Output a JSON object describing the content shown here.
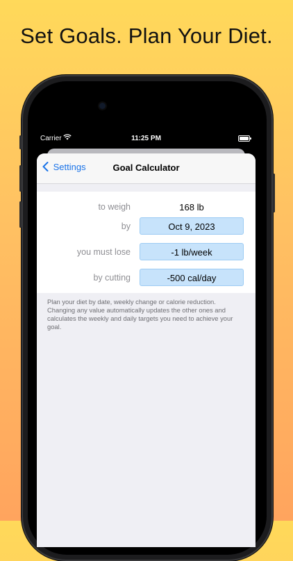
{
  "headline": "Set Goals. Plan Your Diet.",
  "status_bar": {
    "carrier": "Carrier",
    "time": "11:25 PM"
  },
  "nav": {
    "back_label": "Settings",
    "title": "Goal Calculator"
  },
  "form": {
    "rows": [
      {
        "label": "to weigh",
        "value": "168 lb"
      },
      {
        "label": "by",
        "value": "Oct 9, 2023"
      },
      {
        "label": "you must lose",
        "value": "-1 lb/week"
      },
      {
        "label": "by cutting",
        "value": "-500 cal/day"
      }
    ]
  },
  "hint": "Plan your diet by date, weekly change or calorie reduction. Changing any value automatically updates the other ones and calculates the weekly and daily targets you need to achieve your goal.",
  "colors": {
    "accent": "#1a73e8",
    "field_bg": "#c7e3fb",
    "bg_top": "#ffd95a",
    "bg_bottom": "#ffa45e"
  }
}
